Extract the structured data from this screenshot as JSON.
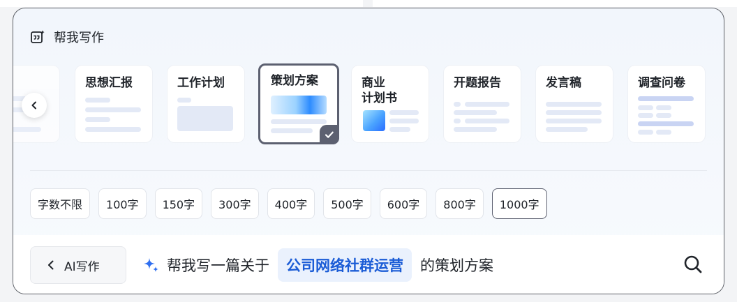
{
  "header": {
    "title": "帮我写作"
  },
  "templates": [
    {
      "label": "思想汇报"
    },
    {
      "label": "工作计划"
    },
    {
      "label": "策划方案"
    },
    {
      "label": "商业\n计划书"
    },
    {
      "label": "开题报告"
    },
    {
      "label": "发言稿"
    },
    {
      "label": "调查问卷"
    }
  ],
  "lengths": [
    "字数不限",
    "100字",
    "150字",
    "300字",
    "400字",
    "500字",
    "600字",
    "800字",
    "1000字"
  ],
  "selected_length": "1000字",
  "selected_template": "策划方案",
  "bottom": {
    "back_label": "AI写作",
    "prompt_prefix": "帮我写一篇关于",
    "topic": "公司网络社群运营",
    "prompt_suffix": "的策划方案"
  },
  "colors": {
    "accent": "#1b5cd6",
    "selected_border": "#5c6070",
    "topic_bg": "#eaf1fd"
  },
  "icons": [
    "writing-quote-icon",
    "chevron-left-icon",
    "check-icon",
    "sparkle-icon",
    "search-icon"
  ]
}
